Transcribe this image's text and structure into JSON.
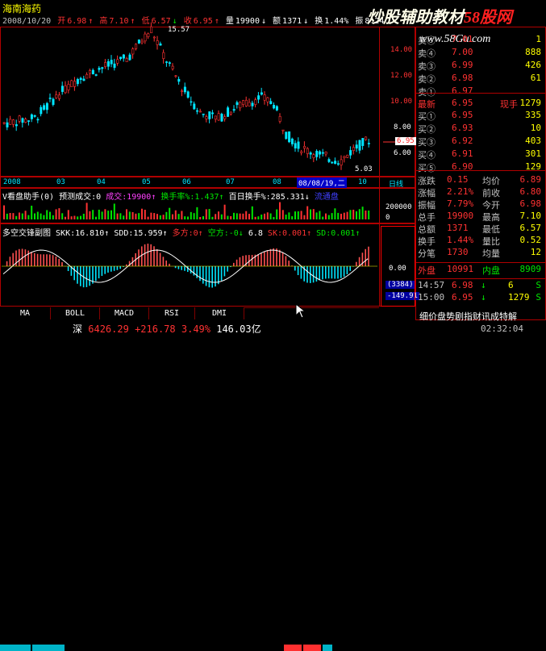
{
  "stock_name": "海南海药",
  "header": {
    "date": "2008/10/20",
    "open_label": "开",
    "open": "6.98",
    "high_label": "高",
    "high": "7.10",
    "low_label": "低",
    "low": "6.57",
    "close_label": "收",
    "close": "6.95",
    "volume_label": "量",
    "volume": "19900",
    "amount_label": "额",
    "amount": "1371",
    "turnover_label": "换",
    "turnover": "1.44%",
    "amplitude_label": "振",
    "amplitude": "8.24"
  },
  "watermark": {
    "text1": "炒股辅助教材",
    "text2": "58股网",
    "url": "www.58Gu.com"
  },
  "main_chart": {
    "price_axis": [
      "14.00",
      "12.00",
      "10.00",
      "8.00",
      "6.00"
    ],
    "high_marker": "15.57",
    "low_marker": "5.03",
    "current_price": "6.95",
    "x_labels": [
      "2008",
      "03",
      "04",
      "05",
      "06",
      "07",
      "08",
      "10"
    ],
    "date_cursor": "08/08/19,二",
    "period": "日线"
  },
  "indicator1": {
    "name": "V看盘助手(0)",
    "pred_label": "预测成交:0",
    "vol_label": "成交:19900",
    "turn_label": "换手率%:1.437",
    "hundred_label": "百日换手%:285.331",
    "extra": "流通盘",
    "axis": "200000",
    "axis_unit": "0"
  },
  "indicator2": {
    "name": "多空交锋副图",
    "skk": "SKK:16.810",
    "sdd": "SDD:15.959",
    "duo": "多方:0",
    "kong": "空方:-0",
    "v68": "6.8",
    "sk": "SK:0.001",
    "sd": "SD:0.001",
    "axis0": "0.00",
    "left_val1": "(3384)",
    "left_val2": "-149.91"
  },
  "buttons": [
    "MA",
    "BOLL",
    "MACD",
    "RSI",
    "DMI"
  ],
  "quotes": {
    "sell": [
      {
        "label": "卖⑤",
        "price": "7.01",
        "vol": "1"
      },
      {
        "label": "卖④",
        "price": "7.00",
        "vol": "888"
      },
      {
        "label": "卖③",
        "price": "6.99",
        "vol": "426"
      },
      {
        "label": "卖②",
        "price": "6.98",
        "vol": "61"
      },
      {
        "label": "卖①",
        "price": "6.97",
        "vol": ""
      }
    ],
    "latest": {
      "label": "最新",
      "price": "6.95",
      "hand_label": "现手",
      "hand": "1279"
    },
    "buy": [
      {
        "label": "买①",
        "price": "6.95",
        "vol": "335"
      },
      {
        "label": "买②",
        "price": "6.93",
        "vol": "10"
      },
      {
        "label": "买③",
        "price": "6.92",
        "vol": "403"
      },
      {
        "label": "买④",
        "price": "6.91",
        "vol": "301"
      },
      {
        "label": "买⑤",
        "price": "6.90",
        "vol": "129"
      }
    ]
  },
  "stats": [
    {
      "l1": "涨跌",
      "v1": "0.15",
      "l2": "均价",
      "v2": "6.89"
    },
    {
      "l1": "涨幅",
      "v1": "2.21%",
      "l2": "前收",
      "v2": "6.80"
    },
    {
      "l1": "振幅",
      "v1": "7.79%",
      "l2": "今开",
      "v2": "6.98"
    },
    {
      "l1": "总手",
      "v1": "19900",
      "l2": "最高",
      "v2": "7.10"
    },
    {
      "l1": "总额",
      "v1": "1371",
      "l2": "最低",
      "v2": "6.57"
    },
    {
      "l1": "换手",
      "v1": "1.44%",
      "l2": "量比",
      "v2": "0.52"
    },
    {
      "l1": "分笔",
      "v1": "1730",
      "l2": "均量",
      "v2": "12"
    }
  ],
  "pan": {
    "outer_label": "外盘",
    "outer": "10991",
    "inner_label": "内盘",
    "inner": "8909"
  },
  "ticks": [
    {
      "time": "14:57",
      "price": "6.98",
      "dir": "↓",
      "vol": "6",
      "flag": "S"
    },
    {
      "time": "15:00",
      "price": "6.95",
      "dir": "↓",
      "vol": "1279",
      "flag": "S"
    }
  ],
  "bottom_link": "细价盘势剧指财讯成特解",
  "status": {
    "index_name": "深",
    "index_value": "6426.29",
    "index_change": "+216.78",
    "index_pct": "3.49%",
    "index_amount": "146.03亿",
    "time": "02:32:04"
  },
  "colors": {
    "up": "#ff3232",
    "down": "#00e600",
    "neutral": "#c0c0c0",
    "border": "#b00000",
    "cyan": "#00e5ff"
  }
}
